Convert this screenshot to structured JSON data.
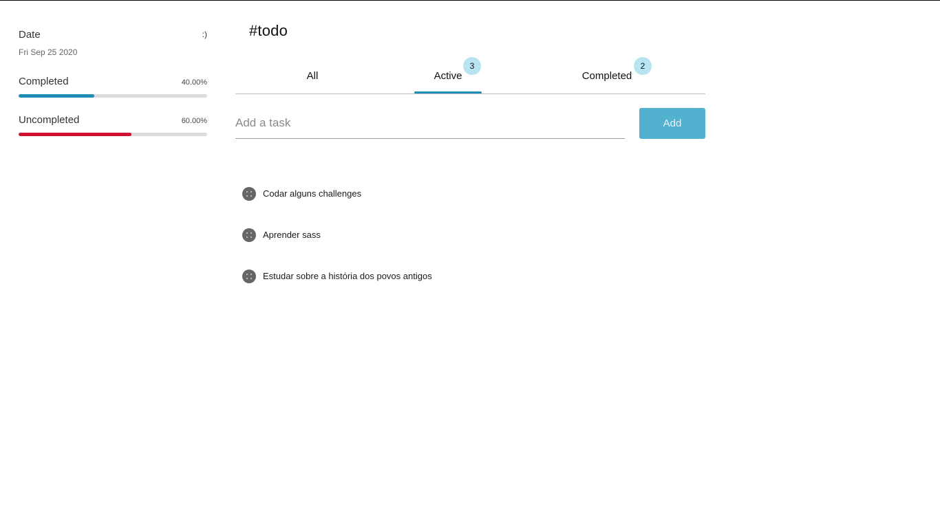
{
  "sidebar": {
    "date_label": "Date",
    "smiley": ":)",
    "date_value": "Fri Sep 25 2020",
    "stats": [
      {
        "label": "Completed",
        "percent_text": "40.00%",
        "fraction": 0.4,
        "color": "#1f8fb8"
      },
      {
        "label": "Uncompleted",
        "percent_text": "60.00%",
        "fraction": 0.6,
        "color": "#d0102f"
      }
    ]
  },
  "header": {
    "title": "#todo"
  },
  "tabs": [
    {
      "label": "All",
      "badge": ""
    },
    {
      "label": "Active",
      "badge": "3",
      "selected": true
    },
    {
      "label": "Completed",
      "badge": "2"
    }
  ],
  "add_form": {
    "placeholder": "Add a task",
    "value": "",
    "button_label": "Add"
  },
  "tasks": [
    {
      "text": "Codar alguns challenges",
      "completed": false
    },
    {
      "text": "Aprender sass",
      "completed": false
    },
    {
      "text": "Estudar sobre a história dos povos antigos",
      "completed": false
    }
  ],
  "colors": {
    "accent": "#1f8fb8",
    "danger": "#d0102f",
    "button": "#51b1cf",
    "badge": "#b7e3f2"
  }
}
